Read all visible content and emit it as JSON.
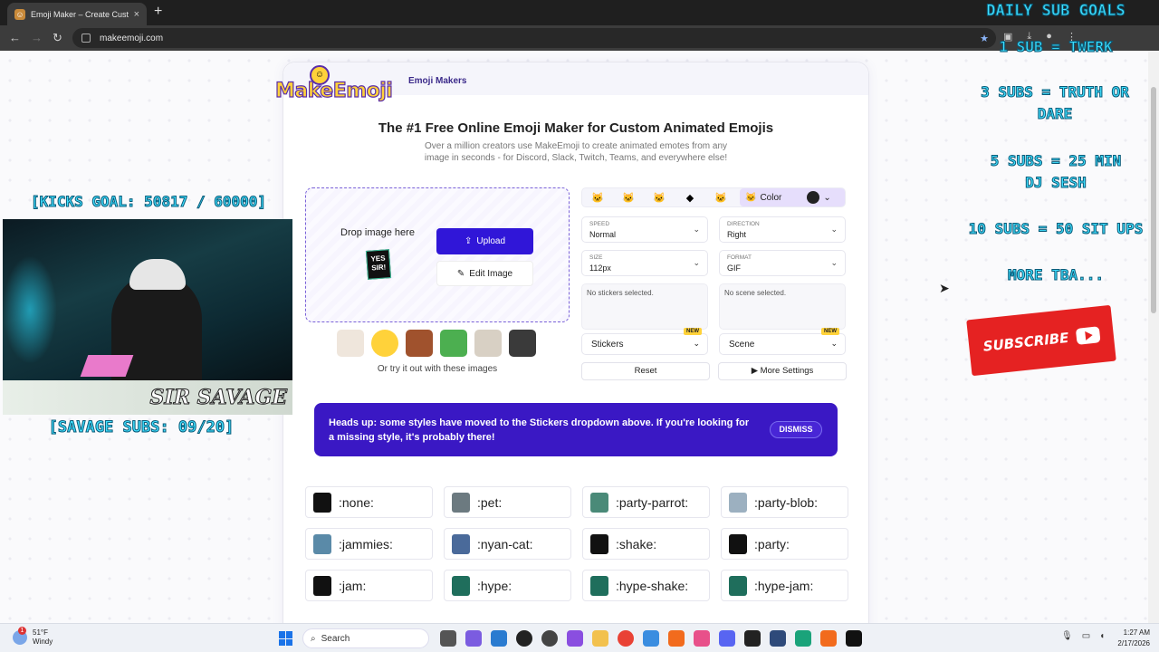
{
  "browser": {
    "tab_title": "Emoji Maker – Create Custom E",
    "url": "makeemoji.com"
  },
  "site": {
    "logo_text": "MakeEmoji",
    "nav_link": "Emoji Makers",
    "headline": "The #1 Free Online Emoji Maker for Custom Animated Emojis",
    "subheadline": "Over a million creators use MakeEmoji to create animated emotes from any image in seconds - for Discord, Slack, Twitch, Teams, and everywhere else!"
  },
  "upload": {
    "drop_text": "Drop image here",
    "upload_label": "Upload",
    "edit_label": "Edit Image",
    "try_text": "Or try it out with these images",
    "yes_badge": "YES SIR!"
  },
  "controls": {
    "color_label": "Color",
    "speed": {
      "label": "SPEED",
      "value": "Normal"
    },
    "direction": {
      "label": "DIRECTION",
      "value": "Right"
    },
    "size": {
      "label": "SIZE",
      "value": "112px"
    },
    "format": {
      "label": "FORMAT",
      "value": "GIF"
    },
    "stickers_empty": "No stickers selected.",
    "scene_empty": "No scene selected.",
    "stickers_label": "Stickers",
    "scene_label": "Scene",
    "new_badge": "NEW",
    "reset_label": "Reset",
    "more_settings_label": "▶ More Settings"
  },
  "banner": {
    "text": "Heads up: some styles have moved to the Stickers dropdown above. If you're looking for a missing style, it's probably there!",
    "dismiss_label": "DISMISS"
  },
  "styles": [
    {
      "name": ":none:"
    },
    {
      "name": ":pet:"
    },
    {
      "name": ":party-parrot:"
    },
    {
      "name": ":party-blob:"
    },
    {
      "name": ":jammies:"
    },
    {
      "name": ":nyan-cat:"
    },
    {
      "name": ":shake:"
    },
    {
      "name": ":party:"
    },
    {
      "name": ":jam:"
    },
    {
      "name": ":hype:"
    },
    {
      "name": ":hype-shake:"
    },
    {
      "name": ":hype-jam:"
    }
  ],
  "overlay": {
    "kicks_goal": "[KICKS GOAL: 50817 / 60000]",
    "streamer_name": "SIR SAVAGE",
    "savage_subs": "[SAVAGE SUBS: 09/20]",
    "goals_title": "DAILY SUB GOALS",
    "goals": [
      "1 SUB = TWERK",
      "3 SUBS = TRUTH OR DARE",
      "5 SUBS = 25 MIN DJ SESH",
      "10 SUBS = 50 SIT UPS",
      "MORE TBA..."
    ],
    "subscribe_label": "SUBSCRIBE"
  },
  "taskbar": {
    "temperature": "51°F",
    "weather": "Windy",
    "search_placeholder": "Search",
    "time": "1:27 AM",
    "date": "2/17/2026"
  },
  "colors": {
    "accent": "#3016d8",
    "banner": "#3a18c4",
    "overlay_text": "#3fe0ff",
    "subscribe": "#e52222"
  }
}
